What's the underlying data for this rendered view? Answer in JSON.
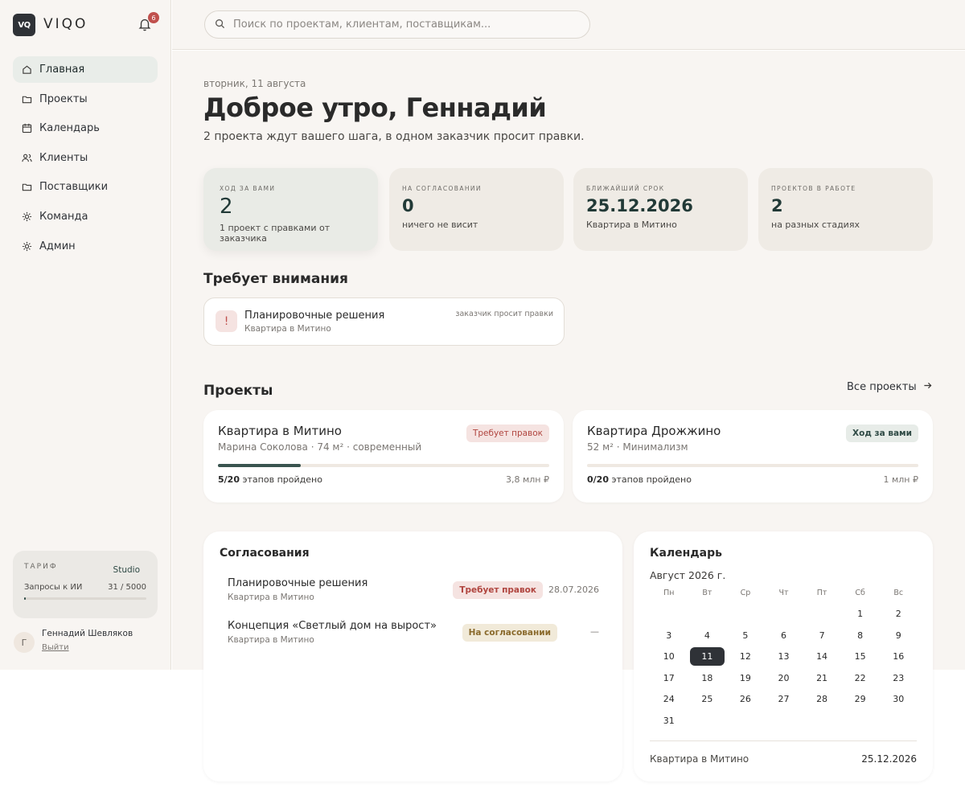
{
  "brand": {
    "logo_mark": "VQ",
    "name": "VIQO"
  },
  "notifications": {
    "count": "6"
  },
  "sidebar": {
    "items": [
      {
        "label": "Главная",
        "icon": "home-icon",
        "active": true
      },
      {
        "label": "Проекты",
        "icon": "folder-icon"
      },
      {
        "label": "Календарь",
        "icon": "calendar-icon"
      },
      {
        "label": "Клиенты",
        "icon": "users-icon"
      },
      {
        "label": "Поставщики",
        "icon": "folder-icon"
      },
      {
        "label": "Команда",
        "icon": "sun-icon"
      },
      {
        "label": "Админ",
        "icon": "sun-icon"
      }
    ],
    "plan": {
      "label": "ТАРИФ",
      "tier": "Studio",
      "usage_label": "Запросы к ИИ",
      "usage_value": "31 / 5000",
      "usage_fraction": 0.0062
    },
    "user": {
      "initial": "Г",
      "name": "Геннадий Шевляков",
      "logout": "Выйти"
    }
  },
  "search": {
    "placeholder": "Поиск по проектам, клиентам, поставщикам..."
  },
  "header": {
    "date": "вторник, 11 августа",
    "greeting": "Доброе утро, Геннадий",
    "subline": "2 проекта ждут вашего шага, в одном заказчик просит правки."
  },
  "stats": [
    {
      "label": "ХОД ЗА ВАМИ",
      "value": "2",
      "note": "1 проект с правками от заказчика"
    },
    {
      "label": "НА СОГЛАСОВАНИИ",
      "value": "0",
      "note": "ничего не висит"
    },
    {
      "label": "БЛИЖАЙШИЙ СРОК",
      "value": "25.12.2026",
      "note": "Квартира в Митино"
    },
    {
      "label": "ПРОЕКТОВ В РАБОТЕ",
      "value": "2",
      "note": "на разных стадиях"
    }
  ],
  "attention": {
    "title": "Требует внимания",
    "item": {
      "mark": "!",
      "title": "Планировочные решения",
      "sub": "Квартира в Митино",
      "note": "заказчик просит правки"
    }
  },
  "projects": {
    "title": "Проекты",
    "all_link": "Все проекты",
    "items": [
      {
        "title": "Квартира в Митино",
        "meta": "Марина Соколова · 74 м² · современный",
        "tag": "Требует правок",
        "steps": "5/20",
        "steps_label": "этапов пройдено",
        "budget": "3,8 млн ₽",
        "progress": 0.25
      },
      {
        "title": "Квартира Дрожжино",
        "meta": "52 м² · Минимализм",
        "tag": "Ход за вами",
        "steps": "0/20",
        "steps_label": "этапов пройдено",
        "budget": "1 млн ₽",
        "progress": 0
      }
    ]
  },
  "approvals": {
    "title": "Согласования",
    "items": [
      {
        "title": "Планировочные решения",
        "sub": "Квартира в Митино",
        "tag": "Требует правок",
        "date": "28.07.2026"
      },
      {
        "title": "Концепция «Светлый дом на вырост»",
        "sub": "Квартира в Митино",
        "tag": "На согласовании",
        "date": "—"
      }
    ]
  },
  "calendar": {
    "title": "Календарь",
    "month": "Август 2026 г.",
    "weekdays": [
      "Пн",
      "Вт",
      "Ср",
      "Чт",
      "Пт",
      "Сб",
      "Вс"
    ],
    "days": [
      "",
      "",
      "",
      "",
      "",
      "1",
      "2",
      "3",
      "4",
      "5",
      "6",
      "7",
      "8",
      "9",
      "10",
      "11",
      "12",
      "13",
      "14",
      "15",
      "16",
      "17",
      "18",
      "19",
      "20",
      "21",
      "22",
      "23",
      "24",
      "25",
      "26",
      "27",
      "28",
      "29",
      "30",
      "31"
    ],
    "today": "11",
    "event": {
      "name": "Квартира в Митино",
      "date": "25.12.2026"
    }
  }
}
